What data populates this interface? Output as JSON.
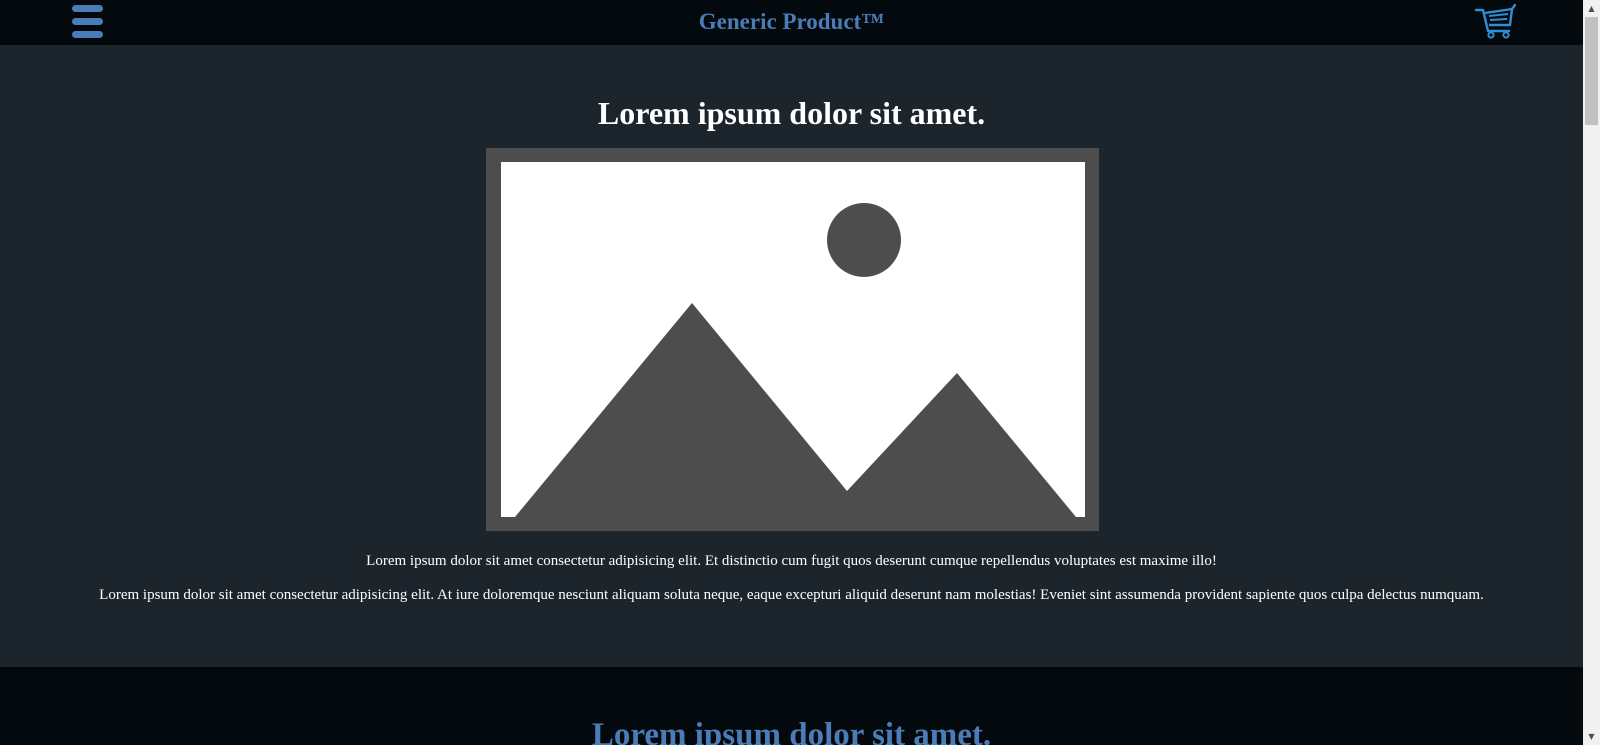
{
  "navbar": {
    "brand": "Generic Product™",
    "menu_icon": "hamburger-menu-icon",
    "cart_icon": "shopping-cart-icon"
  },
  "hero": {
    "title": "Lorem ipsum dolor sit amet.",
    "image_icon": "image-placeholder-icon",
    "paragraphs": [
      "Lorem ipsum dolor sit amet consectetur adipisicing elit. Et distinctio cum fugit quos deserunt cumque repellendus voluptates est maxime illo!",
      "Lorem ipsum dolor sit amet consectetur adipisicing elit. At iure doloremque nesciunt aliquam soluta neque, eaque excepturi aliquid deserunt nam molestias! Eveniet sint assumenda provident sapiente quos culpa delectus numquam."
    ]
  },
  "section2": {
    "title": "Lorem ipsum dolor sit amet."
  },
  "colors": {
    "navbar_bg": "#04090d",
    "page_bg": "#1c252c",
    "accent": "#4a7db8",
    "image_frame": "#4d4d4d"
  }
}
